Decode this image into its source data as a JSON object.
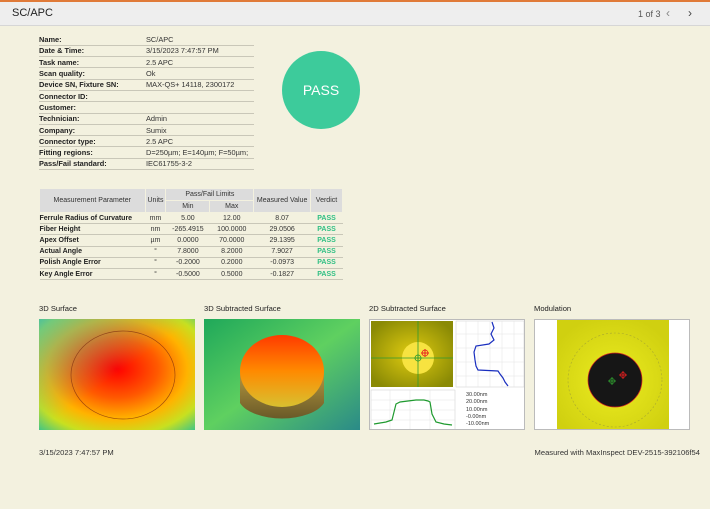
{
  "header": {
    "title": "SC/APC",
    "page_indicator": "1 of 3",
    "prev_icon": "chevron-left-icon",
    "next_icon": "chevron-right-icon"
  },
  "info": [
    {
      "label": "Name:",
      "value": "SC/APC"
    },
    {
      "label": "Date & Time:",
      "value": "3/15/2023 7:47:57 PM"
    },
    {
      "label": "Task name:",
      "value": "2.5 APC"
    },
    {
      "label": "Scan quality:",
      "value": "Ok"
    },
    {
      "label": "Device SN, Fixture SN:",
      "value": "MAX-QS+ 14118, 2300172"
    },
    {
      "label": "Connector ID:",
      "value": ""
    },
    {
      "label": "Customer:",
      "value": ""
    },
    {
      "label": "Technician:",
      "value": "Admin"
    },
    {
      "label": "Company:",
      "value": "Sumix"
    },
    {
      "label": "Connector type:",
      "value": "2.5 APC"
    },
    {
      "label": "Fitting regions:",
      "value": "D=250µm; E=140µm; F=50µm;"
    },
    {
      "label": "Pass/Fail standard:",
      "value": "IEC61755-3-2"
    }
  ],
  "result": {
    "label": "PASS",
    "color": "#3dcb9b"
  },
  "table": {
    "headers": {
      "param": "Measurement Parameter",
      "units": "Units",
      "limits": "Pass/Fail Limits",
      "min": "Min",
      "max": "Max",
      "measured": "Measured Value",
      "verdict": "Verdict"
    },
    "rows": [
      {
        "param": "Ferrule Radius of Curvature",
        "units": "mm",
        "min": "5.00",
        "max": "12.00",
        "measured": "8.07",
        "verdict": "PASS"
      },
      {
        "param": "Fiber Height",
        "units": "nm",
        "min": "-265.4915",
        "max": "100.0000",
        "measured": "29.0506",
        "verdict": "PASS"
      },
      {
        "param": "Apex Offset",
        "units": "µm",
        "min": "0.0000",
        "max": "70.0000",
        "measured": "29.1395",
        "verdict": "PASS"
      },
      {
        "param": "Actual Angle",
        "units": "°",
        "min": "7.8000",
        "max": "8.2000",
        "measured": "7.9027",
        "verdict": "PASS"
      },
      {
        "param": "Polish Angle Error",
        "units": "°",
        "min": "-0.2000",
        "max": "0.2000",
        "measured": "-0.0973",
        "verdict": "PASS"
      },
      {
        "param": "Key Angle Error",
        "units": "°",
        "min": "-0.5000",
        "max": "0.5000",
        "measured": "-0.1827",
        "verdict": "PASS"
      }
    ],
    "verdict_color": "#2fbf83"
  },
  "panels": [
    {
      "title": "3D Surface"
    },
    {
      "title": "3D Subtracted Surface"
    },
    {
      "title": "2D Subtracted Surface"
    },
    {
      "title": "Modulation"
    }
  ],
  "profile_ticks": [
    "30.00nm",
    "20.00nm",
    "10.00nm",
    "-0.00nm",
    "-10.00nm"
  ],
  "footer": {
    "timestamp": "3/15/2023 7:47:57 PM",
    "measured_with": "Measured with MaxInspect DEV-2515-392106f54"
  }
}
